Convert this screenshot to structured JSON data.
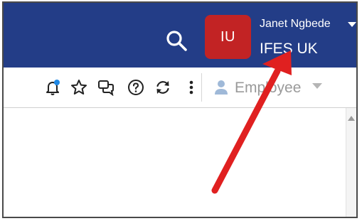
{
  "header": {
    "avatar_initials": "IU",
    "user_name": "Janet Ngbede",
    "org_name": "IFES UK",
    "icons": [
      "search-icon",
      "caret-down-icon"
    ],
    "background_color": "#233d87",
    "avatar_color": "#c22324"
  },
  "toolbar": {
    "icons": [
      "notification-bell-icon",
      "star-icon",
      "chat-icon",
      "help-icon",
      "refresh-icon",
      "more-options-icon",
      "person-icon",
      "caret-down-icon"
    ],
    "role_label": "Employee",
    "notification_dot_color": "#1e88e5"
  },
  "annotation": {
    "arrow_color": "#e02020"
  }
}
